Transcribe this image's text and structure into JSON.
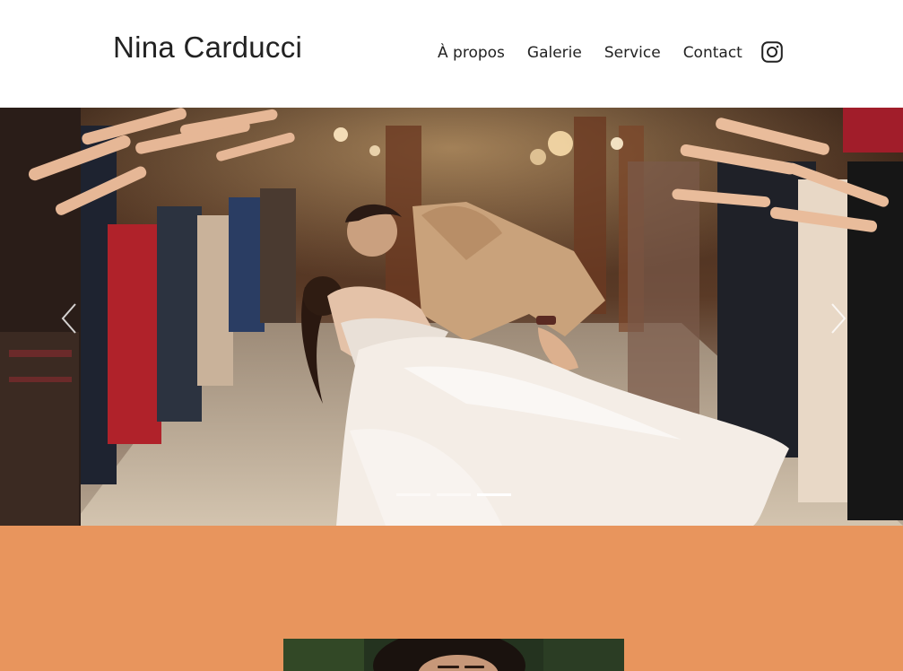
{
  "header": {
    "brand": "Nina Carducci",
    "nav": [
      {
        "label": "À propos"
      },
      {
        "label": "Galerie"
      },
      {
        "label": "Service"
      },
      {
        "label": "Contact"
      }
    ],
    "social_icon": "instagram-icon"
  },
  "carousel": {
    "prev_icon": "chevron-left-icon",
    "next_icon": "chevron-right-icon",
    "slide_count": 3,
    "active_slide": 3
  },
  "colors": {
    "header_bg": "#ffffff",
    "text": "#222222",
    "about_bg": "#e8955d",
    "indicator_active": "#ffffff"
  }
}
